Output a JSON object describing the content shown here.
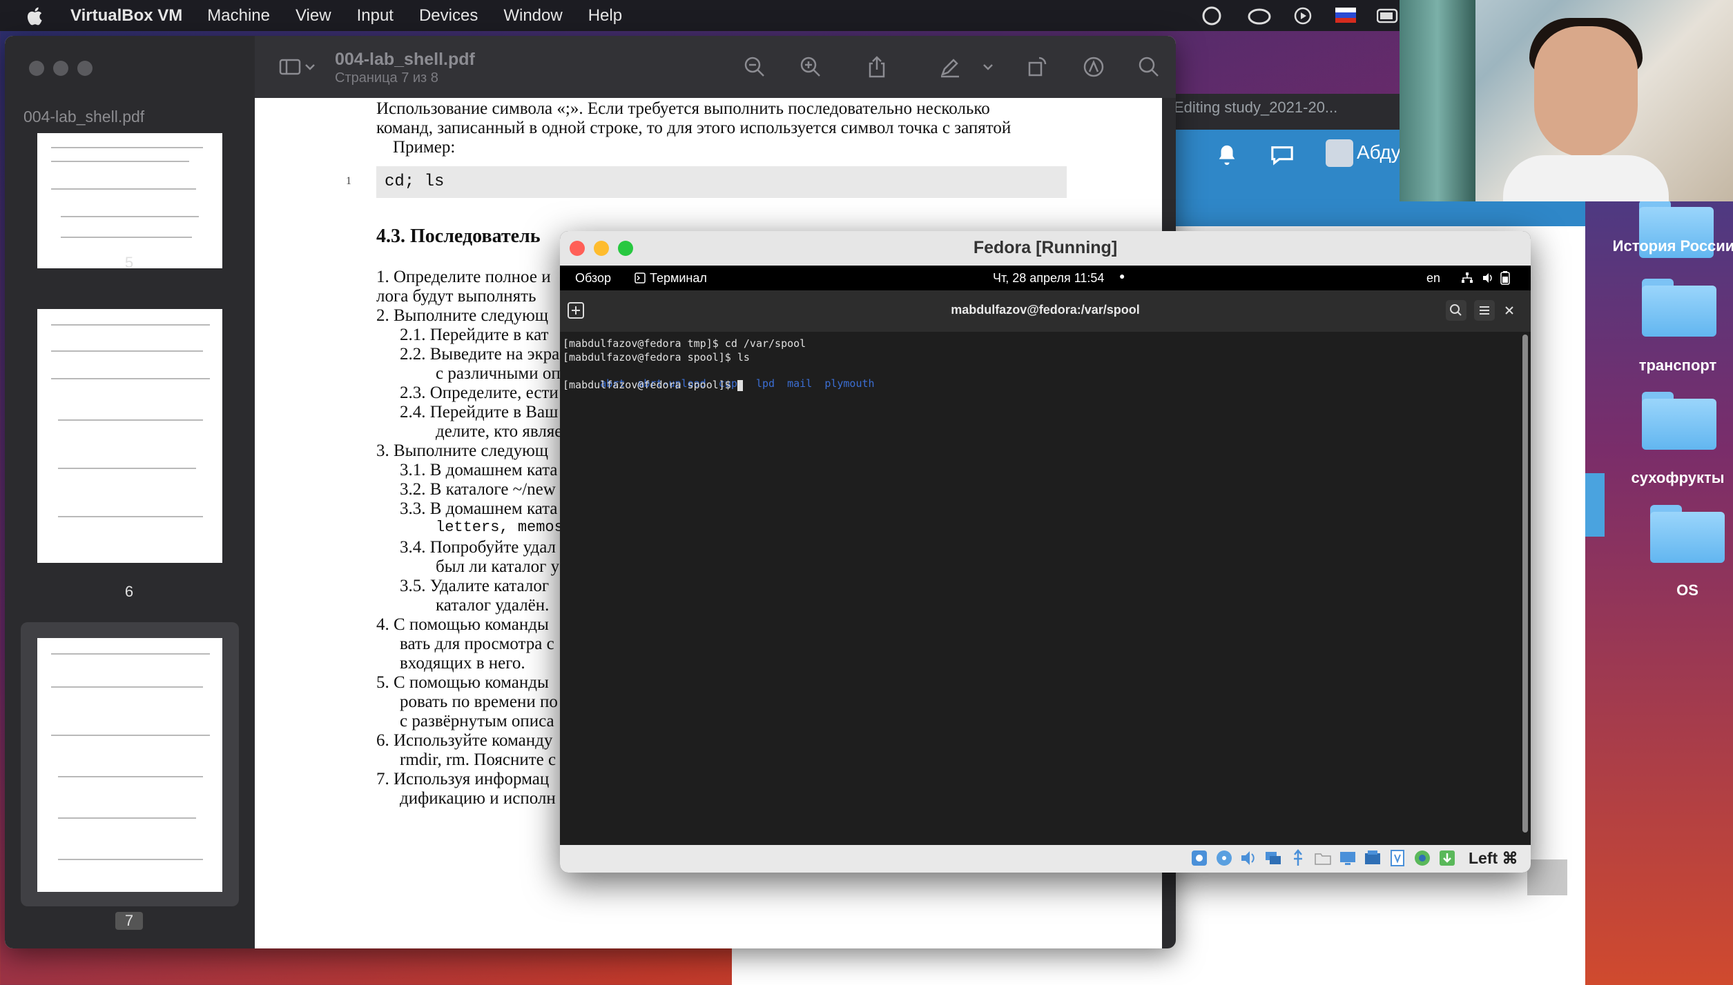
{
  "menubar": {
    "app_name": "VirtualBox VM",
    "items": [
      "Machine",
      "View",
      "Input",
      "Devices",
      "Window",
      "Help"
    ]
  },
  "browser": {
    "tab_title": "Editing study_2021-20...",
    "user_name": "Абдул"
  },
  "desktop": {
    "folders": [
      "История России",
      "транспорт",
      "сухофрукты",
      "OS"
    ]
  },
  "pdf": {
    "sidebar_filename": "004-lab_shell.pdf",
    "title": "004-lab_shell.pdf",
    "subtitle": "Страница 7 из 8",
    "thumb_pages": [
      "5",
      "6",
      "7"
    ],
    "content": {
      "l1": "Использование символа «;».   Если требуется выполнить последовательно несколько",
      "l2": "команд, записанный в одной строке, то для этого используется символ точка с запятой",
      "l3": "Пример:",
      "code_line_no": "1",
      "code": "cd; ls",
      "heading": "4.3.   Последователь",
      "items": [
        "1.  Определите полное и",
        "     лога будут выполнять",
        "2.  Выполните следующ",
        "2.1.  Перейдите в кат",
        "2.2.  Выведите на экра",
        "с различными оп",
        "2.3.  Определите, ести",
        "2.4.  Перейдите в Ваш",
        "делите, кто являе",
        "3.  Выполните следующ",
        "3.1.  В домашнем ката",
        "3.2.  В каталоге ~/new",
        "3.3.  В домашнем ката",
        "letters, memos, m",
        "3.4.  Попробуйте удал",
        "был ли каталог у",
        "3.5.  Удалите каталог",
        "каталог удалён.",
        "4.  С помощью команды",
        "вать для просмотра с",
        "входящих в него.",
        "5.  С помощью команды",
        "ровать по времени по",
        "с развёрнутым описа",
        "6.  Используйте команду",
        "rmdir, rm. Поясните с",
        "7.  Используя информац",
        "дификацию и исполн"
      ]
    }
  },
  "vbox": {
    "title": "Fedora [Running]",
    "gnome": {
      "activities": "Обзор",
      "terminal_app": "Терминал",
      "clock": "Чт, 28 апреля  11:54",
      "lang": "en"
    },
    "terminal": {
      "title": "mabdulfazov@fedora:/var/spool",
      "line1": "[mabdulfazov@fedora tmp]$ cd /var/spool",
      "line2": "[mabdulfazov@fedora spool]$ ls",
      "ls_items": [
        "abrt",
        "abrt-upload",
        "cups",
        "lpd",
        "mail",
        "plymouth"
      ],
      "line4": "[mabdulfazov@fedora spool]$ "
    },
    "host_key": "Left ⌘"
  },
  "colors": {
    "ls_dir": "#3b6ed3",
    "tl_red": "#ff5f57",
    "tl_yellow": "#febc2e",
    "tl_green": "#28c840"
  }
}
